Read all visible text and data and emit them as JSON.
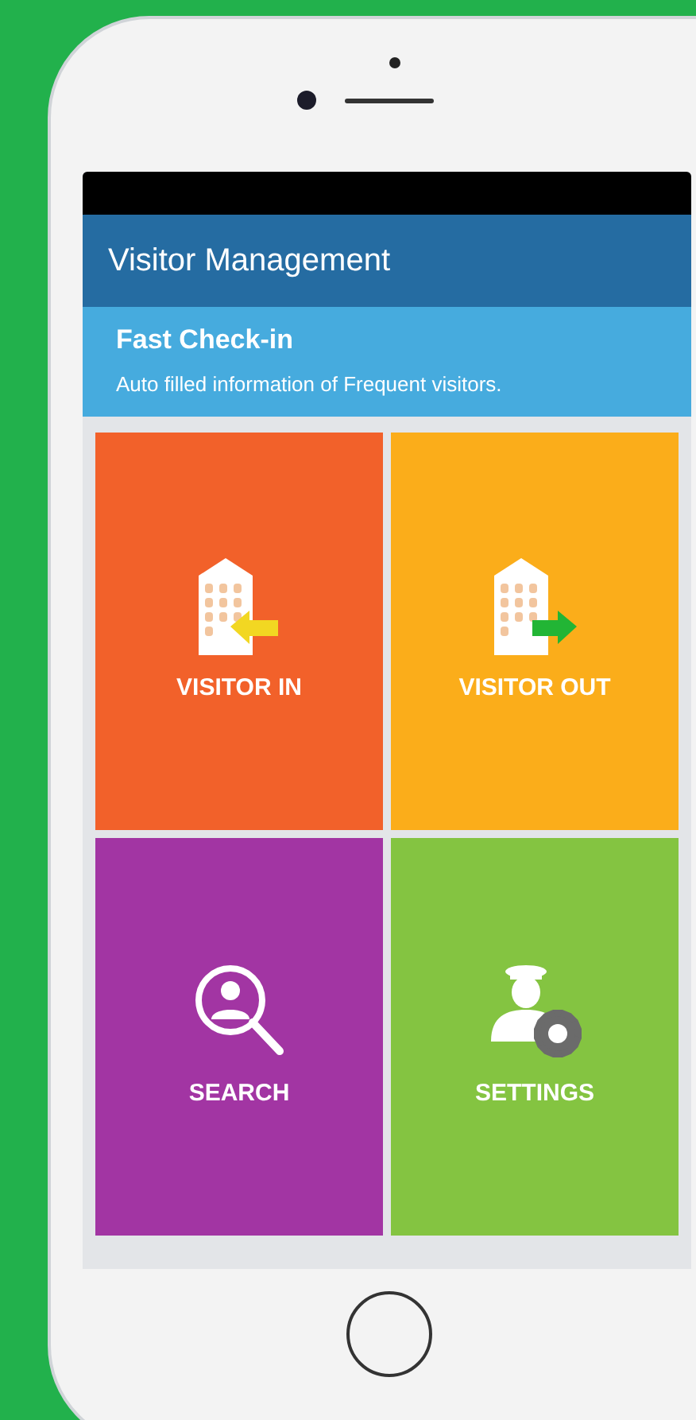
{
  "app_bar": {
    "title": "Visitor Management"
  },
  "banner": {
    "title": "Fast Check-in",
    "subtitle": "Auto filled information of Frequent visitors."
  },
  "tiles": [
    {
      "kind": "visitor-in",
      "label": "VISITOR IN",
      "color": "#f2612a"
    },
    {
      "kind": "visitor-out",
      "label": "VISITOR OUT",
      "color": "#fbad1a"
    },
    {
      "kind": "search",
      "label": "SEARCH",
      "color": "#a235a3"
    },
    {
      "kind": "settings",
      "label": "SETTINGS",
      "color": "#84c441"
    }
  ]
}
